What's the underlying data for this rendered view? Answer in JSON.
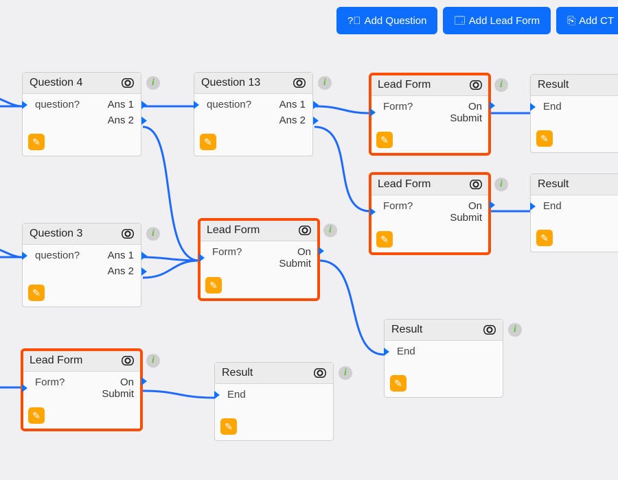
{
  "toolbar": {
    "addQuestion": "Add Question",
    "addLeadForm": "Add Lead Form",
    "addCta": "Add CT"
  },
  "labels": {
    "info": "i",
    "edit": "✎"
  },
  "nodes": {
    "q4": {
      "title": "Question 4",
      "prompt": "question?",
      "ans1": "Ans 1",
      "ans2": "Ans 2"
    },
    "q13": {
      "title": "Question 13",
      "prompt": "question?",
      "ans1": "Ans 1",
      "ans2": "Ans 2"
    },
    "q3": {
      "title": "Question 3",
      "prompt": "question?",
      "ans1": "Ans 1",
      "ans2": "Ans 2"
    },
    "lf1": {
      "title": "Lead Form",
      "prompt": "Form?",
      "out": "On Submit"
    },
    "lf2": {
      "title": "Lead Form",
      "prompt": "Form?",
      "out": "On Submit"
    },
    "lf3": {
      "title": "Lead Form",
      "prompt": "Form?",
      "out": "On Submit"
    },
    "lf4": {
      "title": "Lead Form",
      "prompt": "Form?",
      "out": "On Submit"
    },
    "r1": {
      "title": "Result",
      "end": "End"
    },
    "r2": {
      "title": "Result",
      "end": "End"
    },
    "r3": {
      "title": "Result",
      "end": "End"
    },
    "r4": {
      "title": "Result",
      "end": "End"
    }
  }
}
